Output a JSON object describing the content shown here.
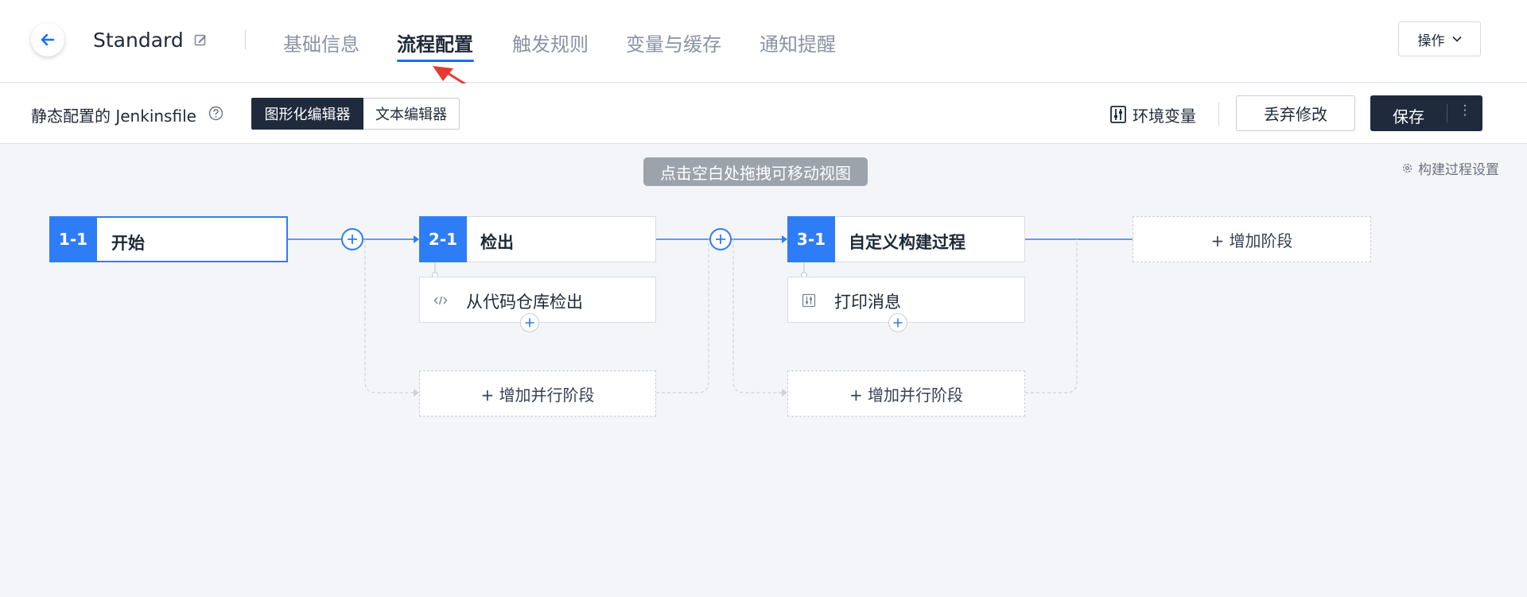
{
  "header": {
    "title": "Standard",
    "tabs": [
      {
        "label": "基础信息"
      },
      {
        "label": "流程配置"
      },
      {
        "label": "触发规则"
      },
      {
        "label": "变量与缓存"
      },
      {
        "label": "通知提醒"
      }
    ],
    "ops_label": "操作"
  },
  "toolbar": {
    "jenkinsfile_label": "静态配置的 Jenkinsfile",
    "graphic_editor": "图形化编辑器",
    "text_editor": "文本编辑器",
    "env_vars": "环境变量",
    "discard": "丢弃修改",
    "save": "保存",
    "more": "⋮"
  },
  "canvas": {
    "hint": "点击空白处拖拽可移动视图",
    "build_settings": "构建过程设置",
    "stages": [
      {
        "num": "1-1",
        "name": "开始"
      },
      {
        "num": "2-1",
        "name": "检出",
        "step": "从代码仓库检出"
      },
      {
        "num": "3-1",
        "name": "自定义构建过程",
        "step": "打印消息"
      }
    ],
    "add_parallel": "+ 增加并行阶段",
    "add_stage": "+ 增加阶段"
  },
  "colors": {
    "primary": "#2f7df6",
    "dark": "#1f2a3d",
    "annotation": "#e53935"
  }
}
